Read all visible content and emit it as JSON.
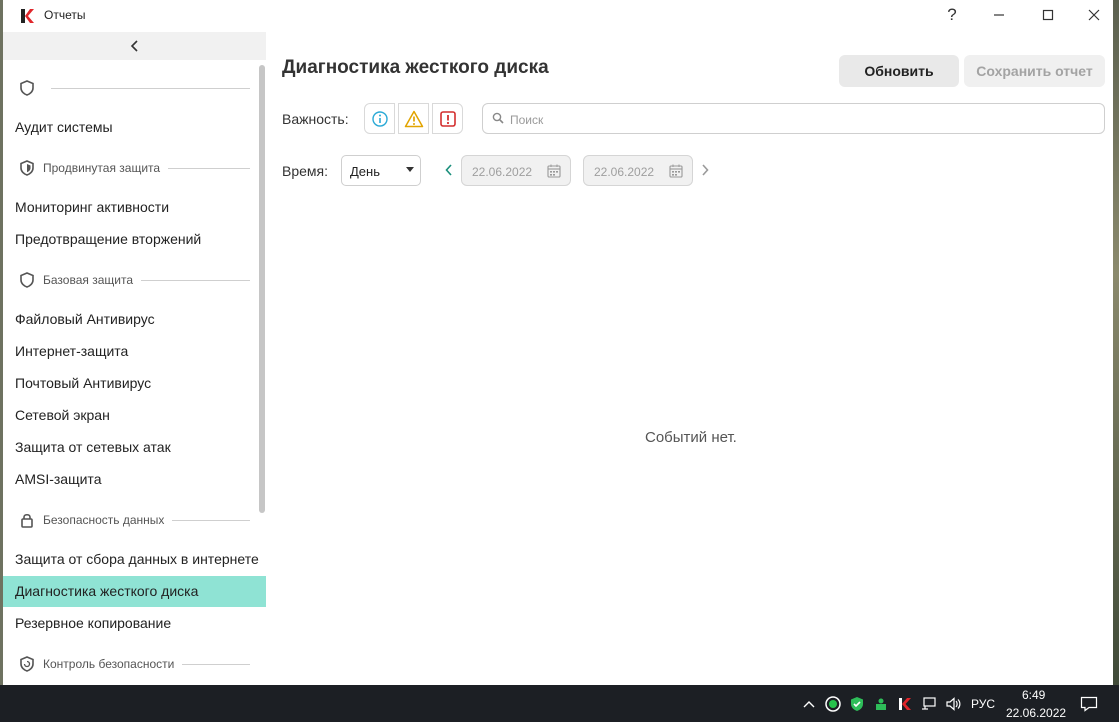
{
  "window": {
    "title": "Отчеты",
    "help_label": "?"
  },
  "sidebar": {
    "top_section": {
      "label": "",
      "icon": "shield-icon"
    },
    "items_top": [
      {
        "label": "Аудит системы"
      }
    ],
    "sections": [
      {
        "label": "Продвинутая защита",
        "icon": "shield-advanced-icon"
      },
      {
        "label": "Базовая защита",
        "icon": "shield-icon"
      },
      {
        "label": "Безопасность данных",
        "icon": "lock-icon"
      },
      {
        "label": "Контроль безопасности",
        "icon": "shield-refresh-icon"
      }
    ],
    "advanced_items": [
      {
        "label": "Мониторинг активности"
      },
      {
        "label": "Предотвращение вторжений"
      }
    ],
    "basic_items": [
      {
        "label": "Файловый Антивирус"
      },
      {
        "label": "Интернет-защита"
      },
      {
        "label": "Почтовый Антивирус"
      },
      {
        "label": "Сетевой экран"
      },
      {
        "label": "Защита от сетевых атак"
      },
      {
        "label": "AMSI-защита"
      }
    ],
    "data_items": [
      {
        "label": "Защита от сбора данных в интернете"
      },
      {
        "label": "Диагностика жесткого диска",
        "active": true
      },
      {
        "label": "Резервное копирование"
      }
    ]
  },
  "main": {
    "title": "Диагностика жесткого диска",
    "refresh_label": "Обновить",
    "save_label": "Сохранить отчет",
    "severity_label": "Важность:",
    "search_placeholder": "Поиск",
    "time_label": "Время:",
    "period_value": "День",
    "date_from": "22.06.2022",
    "date_to": "22.06.2022",
    "empty_message": "Событий нет."
  },
  "colors": {
    "active_item": "#8fe3d4",
    "info": "#2aa9d6",
    "warning": "#e2a400",
    "critical": "#d32f2f",
    "accent_arrow": "#1b8f7c"
  },
  "taskbar": {
    "language": "РУС",
    "time": "6:49",
    "date": "22.06.2022"
  }
}
